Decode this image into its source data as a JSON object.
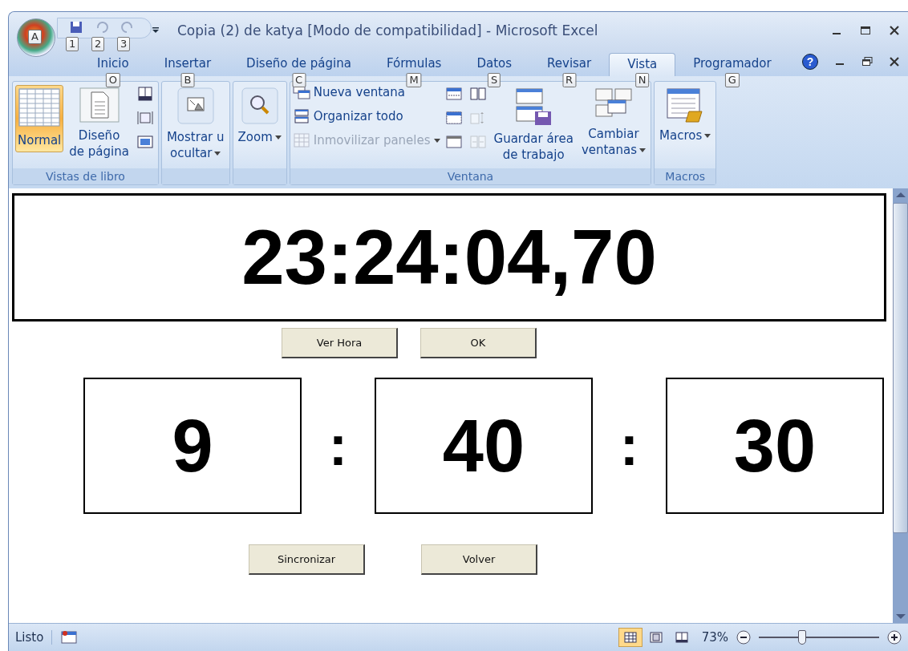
{
  "window": {
    "title": "Copia (2) de katya  [Modo de compatibilidad] - Microsoft Excel",
    "office_keytip": "A",
    "help": "?"
  },
  "quick_access": [
    {
      "keytip": "1",
      "disabled": false
    },
    {
      "keytip": "2",
      "disabled": true
    },
    {
      "keytip": "3",
      "disabled": true
    }
  ],
  "tabs": [
    {
      "label": "Inicio",
      "keytip": "O",
      "selected": false
    },
    {
      "label": "Insertar",
      "keytip": "B",
      "selected": false
    },
    {
      "label": "Diseño de página",
      "keytip": "C",
      "selected": false
    },
    {
      "label": "Fórmulas",
      "keytip": "M",
      "selected": false
    },
    {
      "label": "Datos",
      "keytip": "S",
      "selected": false
    },
    {
      "label": "Revisar",
      "keytip": "R",
      "selected": false
    },
    {
      "label": "Vista",
      "keytip": "N",
      "selected": true
    },
    {
      "label": "Programador",
      "keytip": "G",
      "selected": false
    }
  ],
  "ribbon_groups": [
    {
      "name": "Vistas de libro",
      "items": [
        {
          "kind": "large",
          "label": "Normal",
          "selected": true
        },
        {
          "kind": "large",
          "label": "Diseño\nde página",
          "selected": false
        },
        {
          "kind": "smallicons"
        }
      ]
    },
    {
      "items": [
        {
          "kind": "large",
          "label": "Mostrar u\nocultar",
          "selected": false,
          "dropdown": true
        }
      ]
    },
    {
      "items": [
        {
          "kind": "large",
          "label": "Zoom",
          "selected": false,
          "dropdown": true
        }
      ]
    },
    {
      "name": "Ventana",
      "items": [
        {
          "kind": "smalllist",
          "entries": [
            {
              "label": "Nueva ventana",
              "disabled": false
            },
            {
              "label": "Organizar todo",
              "disabled": false
            },
            {
              "label": "Inmovilizar paneles",
              "disabled": true
            }
          ]
        },
        {
          "kind": "smallicons"
        },
        {
          "kind": "smallicons"
        },
        {
          "kind": "large",
          "label": "Guardar área\nde trabajo",
          "selected": false
        },
        {
          "kind": "large",
          "label": "Cambiar\nventanas",
          "selected": false,
          "dropdown": true
        }
      ]
    },
    {
      "name": "Macros",
      "items": [
        {
          "kind": "large",
          "label": "Macros",
          "selected": false,
          "dropdown": true
        }
      ]
    }
  ],
  "sheet": {
    "clock": "23:24:04,70",
    "buttons_top": [
      "Ver Hora",
      "OK"
    ],
    "fields": [
      "9",
      "40",
      "30"
    ],
    "separator": ":",
    "buttons_bottom": [
      "Sincronizar",
      "Volver"
    ]
  },
  "status_bar": {
    "status": "Listo",
    "views": [
      {
        "selected": true
      },
      {
        "selected": false
      },
      {
        "selected": false
      }
    ],
    "zoom": "73%",
    "level": 0.36
  }
}
